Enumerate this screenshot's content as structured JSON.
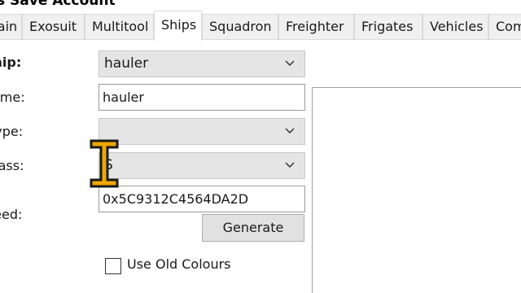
{
  "window": {
    "title": "s Save Account"
  },
  "tabs": [
    {
      "label": "Main",
      "active": false
    },
    {
      "label": "Exosuit",
      "active": false
    },
    {
      "label": "Multitool",
      "active": false
    },
    {
      "label": "Ships",
      "active": true
    },
    {
      "label": "Squadron",
      "active": false
    },
    {
      "label": "Freighter",
      "active": false
    },
    {
      "label": "Frigates",
      "active": false
    },
    {
      "label": "Vehicles",
      "active": false
    },
    {
      "label": "Company",
      "active": false
    }
  ],
  "form": {
    "ship_label": "Ship:",
    "ship_value": "hauler",
    "name_label": "Name:",
    "name_value": "hauler",
    "type_label": "Type:",
    "type_value": "",
    "class_label": "Class:",
    "class_value": "S",
    "seed_label": "Seed:",
    "seed_value": "0x5C9312C4564DA2D",
    "generate_label": "Generate",
    "use_old_colours_label": "Use Old Colours",
    "use_old_colours_checked": false
  },
  "icons": {
    "dropdown": "chevron-down-icon",
    "cursor": "text-cursor-icon"
  },
  "colors": {
    "tab_active_bg": "#ffffff",
    "tab_bg": "#f0f0f0",
    "combo_bg": "#e5e5e5",
    "button_bg": "#e1e1e1",
    "cursor_fill": "#f0a800"
  }
}
